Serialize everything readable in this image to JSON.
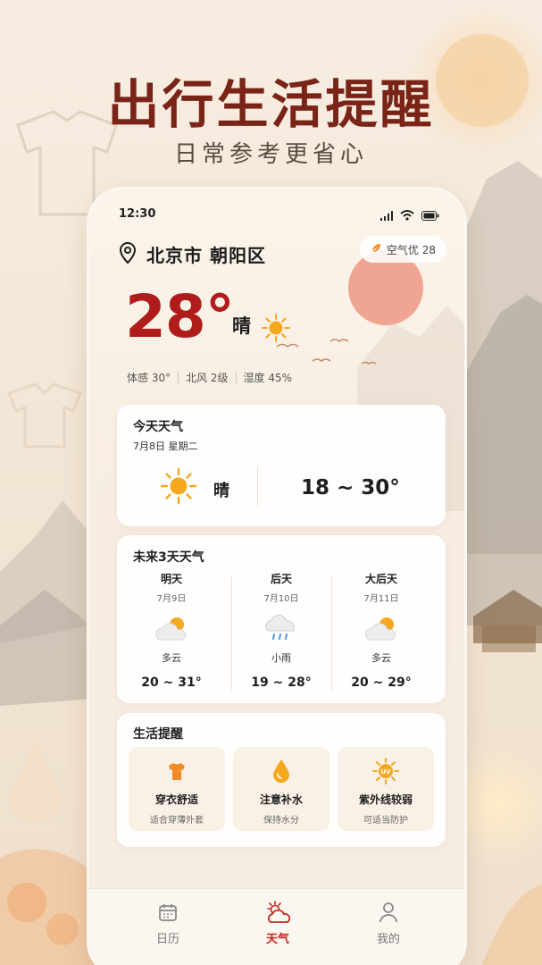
{
  "promo": {
    "headline": "出行生活提醒",
    "subline": "日常参考更省心"
  },
  "status_bar": {
    "time": "12:30"
  },
  "location": {
    "name": "北京市 朝阳区",
    "icon": "location-pin-icon"
  },
  "air_quality": {
    "label": "空气优 28",
    "icon": "leaf-icon"
  },
  "current": {
    "temperature": "28°",
    "condition": "晴",
    "feels_like": "体感 30°",
    "wind": "北风 2级",
    "humidity": "湿度 45%"
  },
  "today": {
    "title": "今天天气",
    "date": "7月8日 星期二",
    "condition": "晴",
    "range": "18 ~ 30°"
  },
  "forecast": {
    "title": "未来3天天气",
    "days": [
      {
        "day": "明天",
        "date": "7月9日",
        "condition": "多云",
        "range": "20 ~ 31°",
        "icon": "partly-cloudy-icon"
      },
      {
        "day": "后天",
        "date": "7月10日",
        "condition": "小雨",
        "range": "19 ~ 28°",
        "icon": "light-rain-icon"
      },
      {
        "day": "大后天",
        "date": "7月11日",
        "condition": "多云",
        "range": "20 ~ 29°",
        "icon": "partly-cloudy-icon"
      }
    ]
  },
  "life": {
    "title": "生活提醒",
    "items": [
      {
        "title": "穿衣舒适",
        "sub": "适合穿薄外套",
        "icon": "tshirt-icon"
      },
      {
        "title": "注意补水",
        "sub": "保持水分",
        "icon": "water-drop-icon"
      },
      {
        "title": "紫外线较弱",
        "sub": "可适当防护",
        "icon": "uv-sun-icon",
        "badge": "UV"
      }
    ]
  },
  "tabs": [
    {
      "label": "日历",
      "icon": "calendar-icon",
      "active": false
    },
    {
      "label": "天气",
      "icon": "weather-icon",
      "active": true
    },
    {
      "label": "我的",
      "icon": "profile-icon",
      "active": false
    }
  ],
  "colors": {
    "accent": "#c8261c",
    "headline": "#7a2418",
    "sun": "#f4a81d",
    "temperature": "#b01c1c"
  }
}
